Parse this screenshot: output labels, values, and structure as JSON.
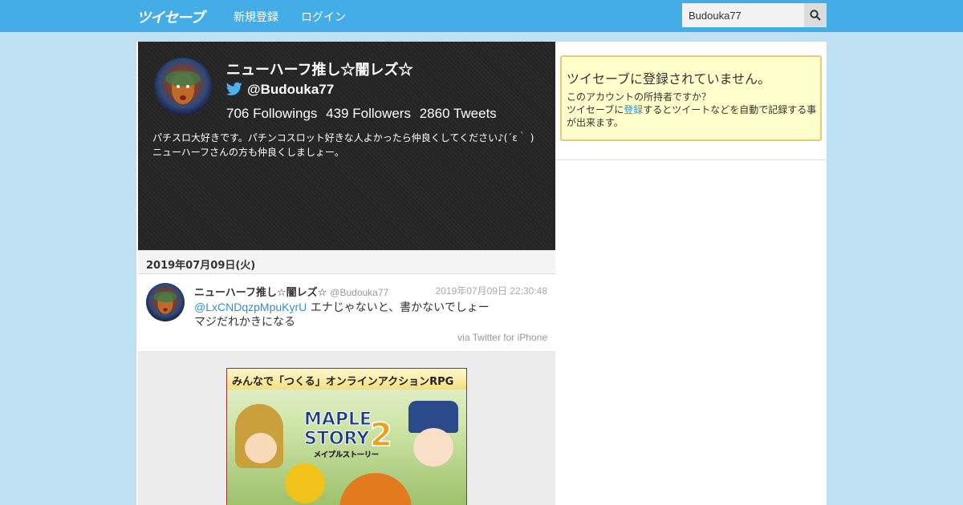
{
  "header": {
    "logo_text": "ツイセーブ",
    "nav": {
      "signup": "新規登録",
      "login": "ログイン"
    },
    "search": {
      "value": "Budouka77",
      "icon": "search-icon"
    },
    "bg_color": "#44ade8"
  },
  "profile": {
    "name": "ニューハーフ推し☆闇レズ☆",
    "handle": "@Budouka77",
    "followings": "706 Followings",
    "followers": "439 Followers",
    "tweets": "2860 Tweets",
    "bio": "パチスロ大好きです。パチンコスロット好きな人よかったら仲良くしてください♪(´ε｀ ) ニューハーフさんの方も仲良くしましょー。"
  },
  "timeline": {
    "date_header": "2019年07月09日(火)",
    "tweets": [
      {
        "name": "ニューハーフ推し☆闇レズ☆",
        "handle": "@Budouka77",
        "time": "2019年07月09日 22:30:48",
        "mention": "@LxCNDqzpMpuKyrU",
        "text_line1": " エナじゃないと、書かないでしょー",
        "text_line2": "マジだれかきになる",
        "via": "via Twitter for iPhone"
      }
    ]
  },
  "ad": {
    "headline": "みんなで「つくる」オンラインアクションRPG",
    "logo_line1": "MAPLE",
    "logo_line2": "STORY",
    "logo_number": "2",
    "logo_sub": "メイプルストーリー"
  },
  "notice": {
    "title": "ツイセーブに登録されていません。",
    "line1": "このアカウントの所持者ですか？",
    "line2_pre": "ツイセーブに",
    "line2_link": "登録",
    "line2_post": "するとツイートなどを自動で記録する事が出来ます。"
  }
}
